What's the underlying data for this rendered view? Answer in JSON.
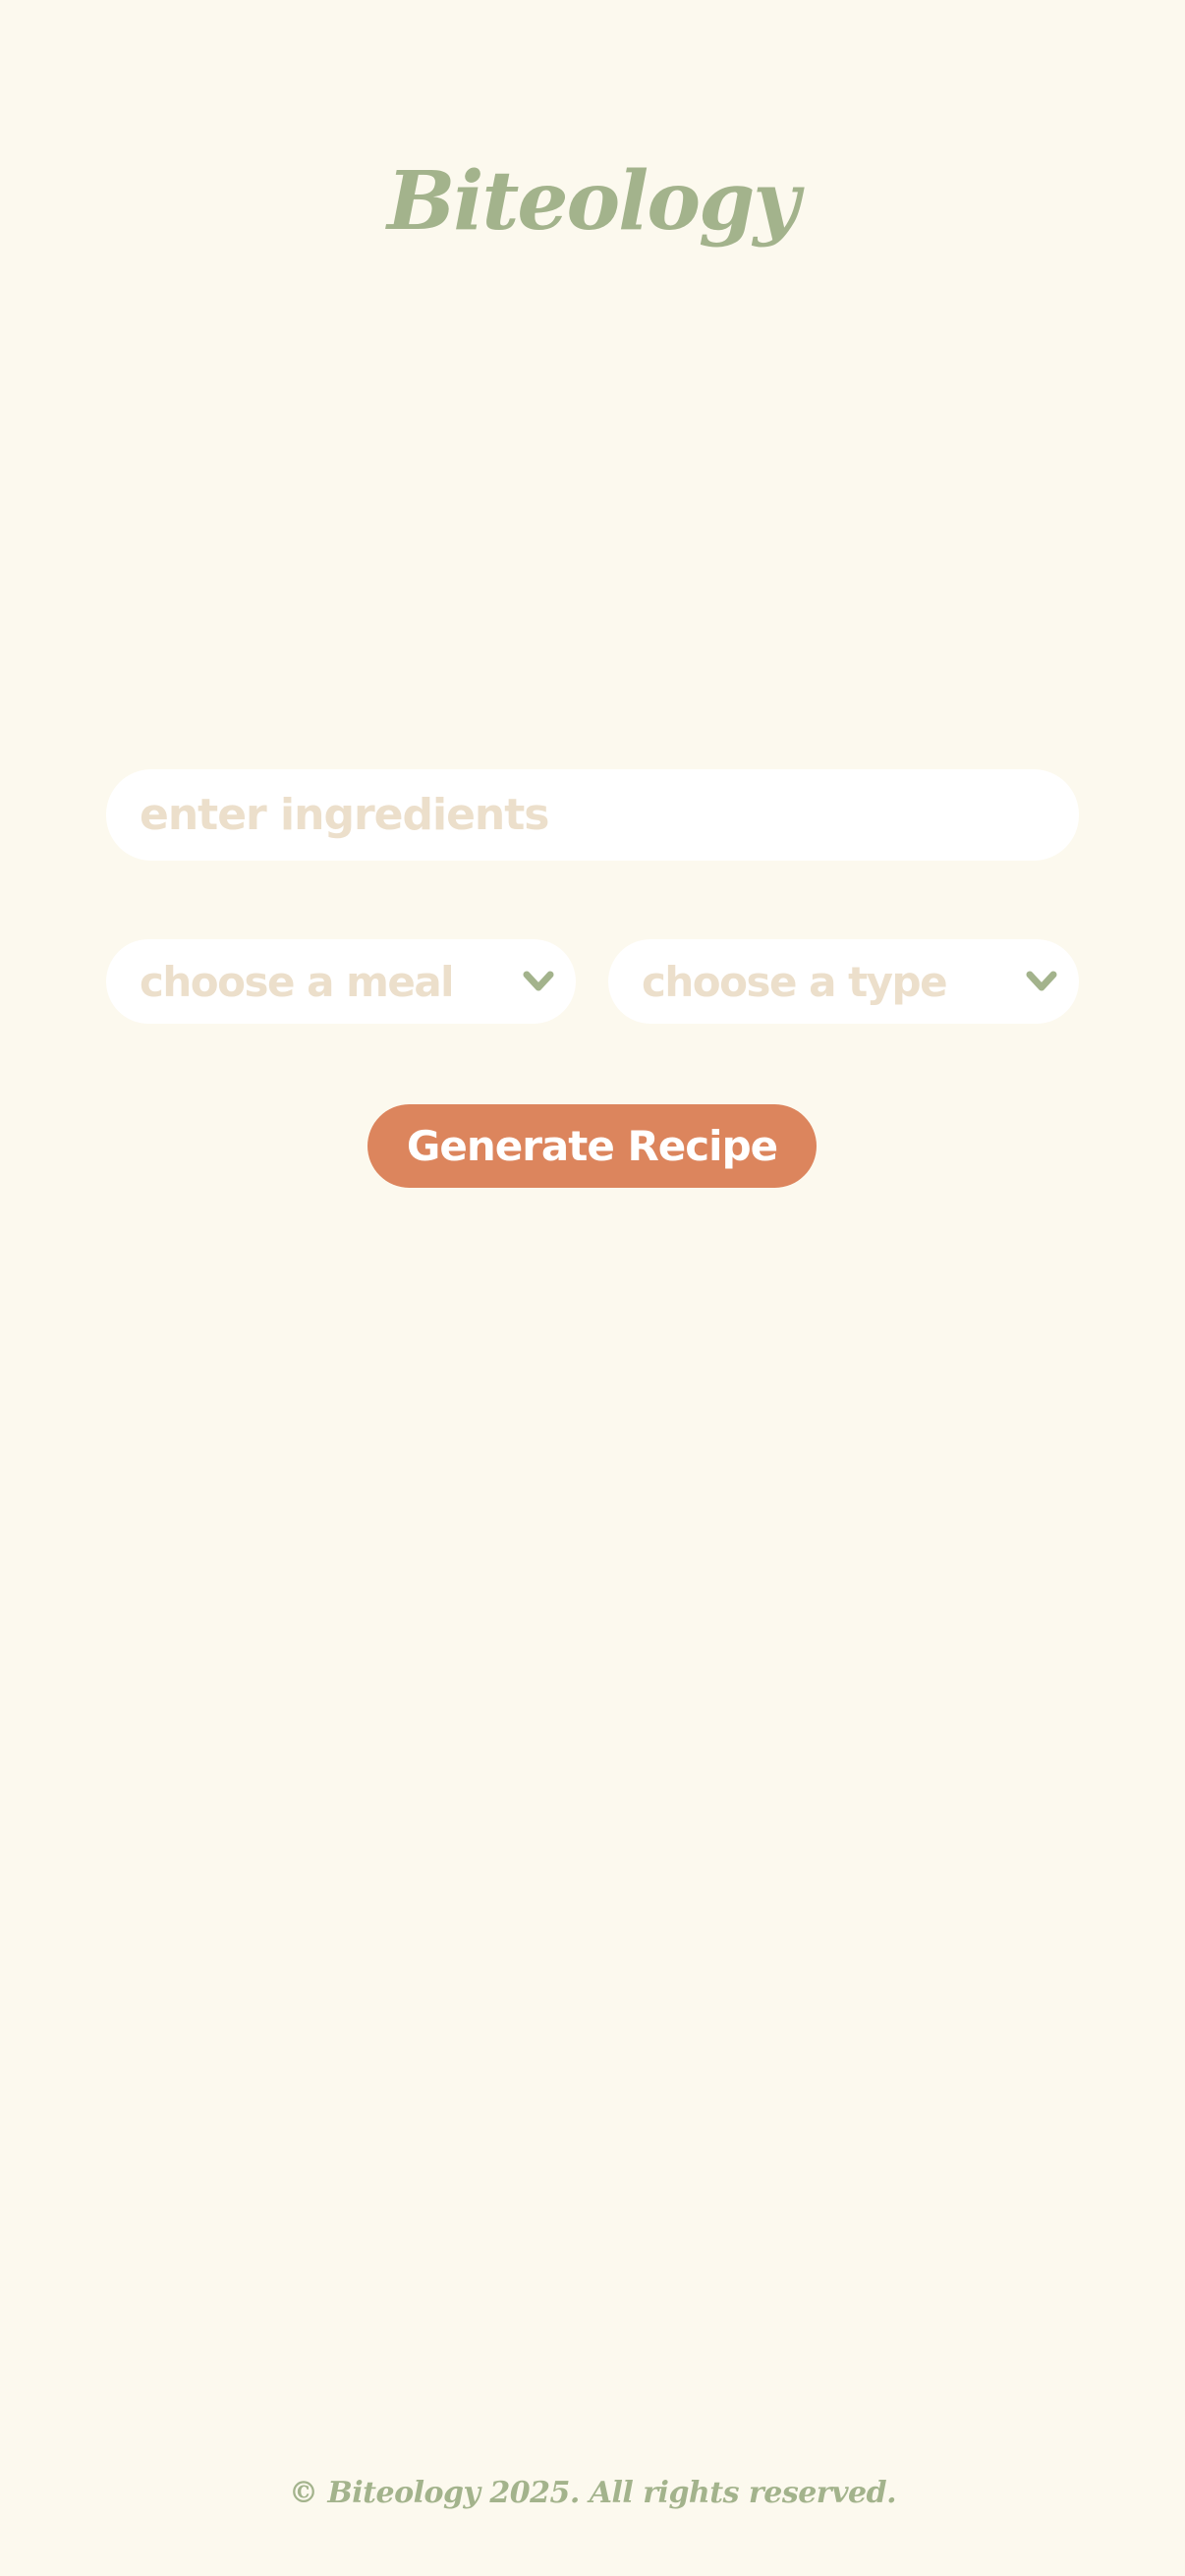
{
  "app": {
    "title": "Biteology"
  },
  "form": {
    "ingredients_placeholder": "enter ingredients",
    "ingredients_value": "",
    "meal_select_label": "choose a meal",
    "type_select_label": "choose a type",
    "generate_button_label": "Generate Recipe"
  },
  "footer": {
    "copyright": "© Biteology 2025. All rights reserved."
  },
  "icons": {
    "dropdown": "chevron-down-icon"
  },
  "colors": {
    "background": "#fcf9ee",
    "brand_green": "#a3b38c",
    "placeholder": "#ecdfcb",
    "accent_button": "#dc855d",
    "field_background": "#ffffff"
  }
}
